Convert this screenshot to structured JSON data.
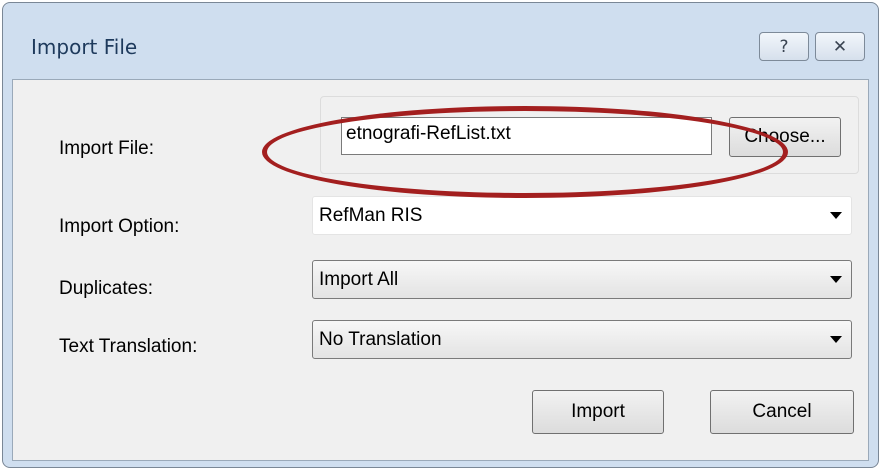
{
  "window": {
    "title": "Import File",
    "help_glyph": "?",
    "close_glyph": "✕"
  },
  "form": {
    "import_file_label": "Import File:",
    "import_file_value": "etnografi-RefList.txt",
    "choose_label": "Choose...",
    "import_option_label": "Import Option:",
    "import_option_value": "RefMan RIS",
    "duplicates_label": "Duplicates:",
    "duplicates_value": "Import All",
    "text_translation_label": "Text Translation:",
    "text_translation_value": "No Translation"
  },
  "buttons": {
    "import_label": "Import",
    "cancel_label": "Cancel"
  },
  "annotation": {
    "color": "#a31f1f"
  }
}
